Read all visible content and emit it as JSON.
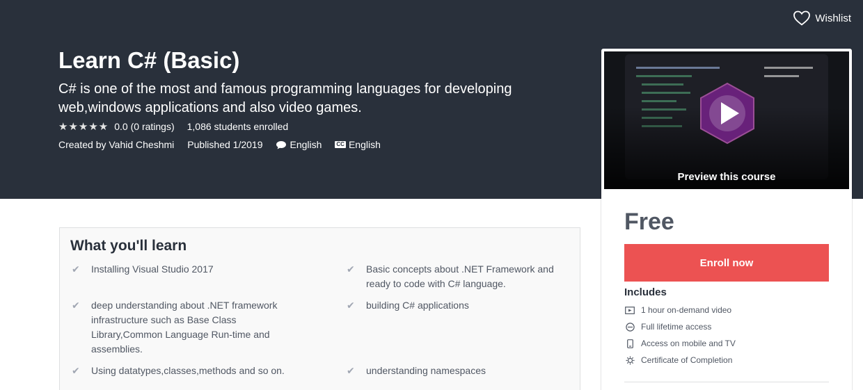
{
  "header": {
    "wishlist_label": "Wishlist",
    "title": "Learn C# (Basic)",
    "subtitle": "C# is one of the most and famous programming languages for developing web,windows applications and also video games.",
    "stars": "★★★★★",
    "rating": "0.0 (0 ratings)",
    "students": "1,086 students enrolled",
    "created_by": "Created by Vahid Cheshmi",
    "published": "Published 1/2019",
    "language": "English",
    "captions_badge": "CC",
    "captions": "English"
  },
  "sidebar": {
    "preview_label": "Preview this course",
    "price": "Free",
    "enroll_label": "Enroll now",
    "includes_title": "Includes",
    "includes": [
      {
        "icon": "video-icon",
        "label": "1 hour on-demand video"
      },
      {
        "icon": "infinity-icon",
        "label": "Full lifetime access"
      },
      {
        "icon": "mobile-icon",
        "label": "Access on mobile and TV"
      },
      {
        "icon": "certificate-icon",
        "label": "Certificate of Completion"
      }
    ]
  },
  "learn": {
    "title": "What you'll learn",
    "check_glyph": "✔",
    "items": [
      "Installing Visual Studio 2017",
      "Basic concepts about .NET Framework and ready to code with C# language.",
      "deep understanding about .NET framework infrastructure such as Base Class Library,Common Language Run-time and assemblies.",
      "building C# applications",
      "Using datatypes,classes,methods and so on.",
      "understanding namespaces"
    ]
  },
  "colors": {
    "hero_bg": "#29303b",
    "enroll_bg": "#ec5252",
    "play_purple": "#68217a"
  }
}
